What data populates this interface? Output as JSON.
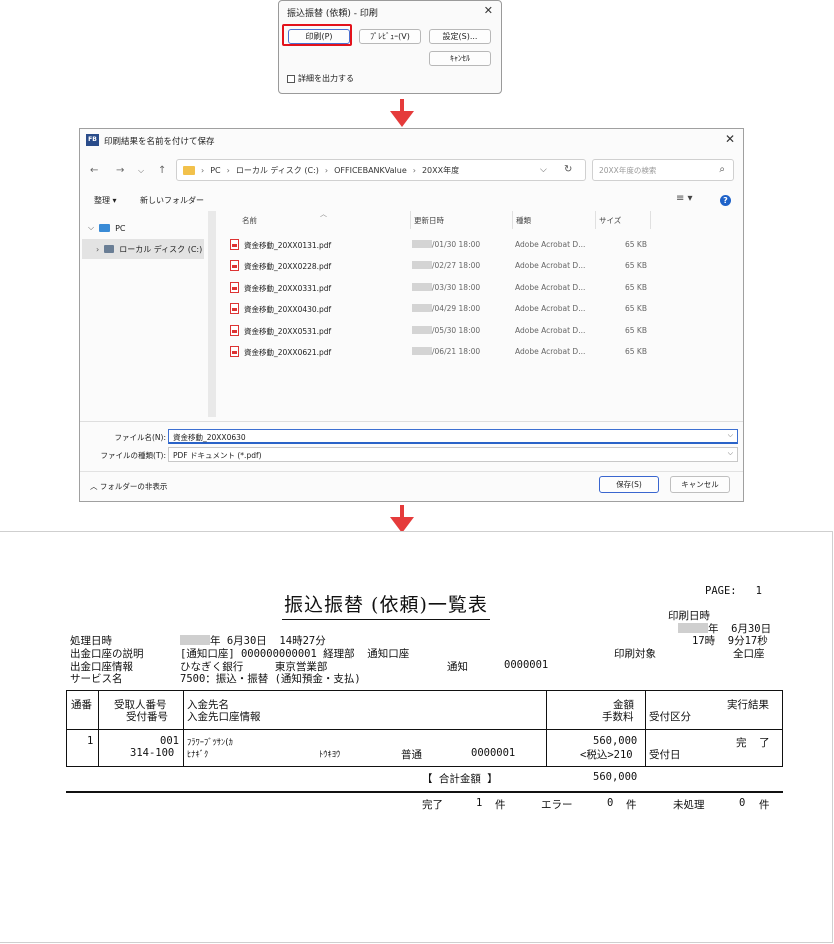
{
  "print_dialog": {
    "title": "振込振替 (依頼) - 印刷",
    "close_icon": "close-icon",
    "print_button": "印刷(P)",
    "preview_button": "ﾌﾟﾚﾋﾞｭｰ(V)",
    "settings_button": "設定(S)...",
    "cancel_button": "ｷｬﾝｾﾙ",
    "detail_checkbox_label": "詳細を出力する",
    "detail_checked": false,
    "highlight_color": "#e3121b"
  },
  "arrow_color": "#e53b3b",
  "save_dialog": {
    "app_icon_text": "FB",
    "title": "印刷結果を名前を付けて保存",
    "address": [
      "PC",
      "ローカル ディスク (C:)",
      "OFFICEBANKValue",
      "20XX年度"
    ],
    "search_placeholder": "20XX年度の検索",
    "toolbar": {
      "organize": "整理 ▾",
      "new_folder": "新しいフォルダー"
    },
    "nav": {
      "pc": "PC",
      "disk": "ローカル ディスク (C:)"
    },
    "columns": {
      "name": "名前",
      "modified": "更新日時",
      "type": "種類",
      "size": "サイズ"
    },
    "files": [
      {
        "name": "資金移動_20XX0131.pdf",
        "date": "/01/30 18:00",
        "type": "Adobe Acrobat D...",
        "size": "65 KB"
      },
      {
        "name": "資金移動_20XX0228.pdf",
        "date": "/02/27 18:00",
        "type": "Adobe Acrobat D...",
        "size": "65 KB"
      },
      {
        "name": "資金移動_20XX0331.pdf",
        "date": "/03/30 18:00",
        "type": "Adobe Acrobat D...",
        "size": "65 KB"
      },
      {
        "name": "資金移動_20XX0430.pdf",
        "date": "/04/29 18:00",
        "type": "Adobe Acrobat D...",
        "size": "65 KB"
      },
      {
        "name": "資金移動_20XX0531.pdf",
        "date": "/05/30 18:00",
        "type": "Adobe Acrobat D...",
        "size": "65 KB"
      },
      {
        "name": "資金移動_20XX0621.pdf",
        "date": "/06/21 18:00",
        "type": "Adobe Acrobat D...",
        "size": "65 KB"
      }
    ],
    "filename_label": "ファイル名(N):",
    "filename_value": "資金移動_20XX0630",
    "filetype_label": "ファイルの種類(T):",
    "filetype_value": "PDF ドキュメント (*.pdf)",
    "hide_folders": "フォルダーの非表示",
    "save_button": "保存(S)",
    "cancel_button": "キャンセル"
  },
  "report": {
    "page": "PAGE:   1",
    "title": "振込振替 (依頼)一覧表",
    "print_date_label": "印刷日時",
    "print_date": "年  6月30日",
    "print_time": "17時  9分17秒",
    "processing_label": "処理日時",
    "processing_value": "年 6月30日  14時27分",
    "account_desc_label": "出金口座の説明",
    "account_desc_value": "[通知口座] 000000000001 経理部  通知口座",
    "account_info_label": "出金口座情報",
    "account_info_value": "ひなぎく銀行     東京営業部",
    "account_type": "通知",
    "account_number": "0000001",
    "service_label": "サービス名",
    "service_value": "7500：振込・振替 (通知預金・支払)",
    "print_target_label": "印刷対象",
    "print_target_value": "全口座",
    "headers": {
      "seq": "通番",
      "recv_no": "受取人番号",
      "accept_no": "受付番号",
      "payee": "入金先名",
      "payee_account": "入金先口座情報",
      "amount": "金額",
      "fee": "手数料",
      "accept_type": "受付区分",
      "result": "実行結果"
    },
    "row": {
      "seq": "1",
      "recv_no": "001",
      "accept_no": "314-100",
      "payee_kana": "ﾌﾗﾜｰﾌﾞﾂｻﾝ(ｶ",
      "bank_kana": "ﾋﾅｷﾞｸ",
      "branch_kana": "ﾄｳｷﾖｳ",
      "acct_type": "普通",
      "acct_no": "0000001",
      "amount": "560,000",
      "fee": "<税込>210",
      "accept_date": "受付日",
      "result": "完  了"
    },
    "total_label": "【 合計金額 】",
    "total_value": "560,000",
    "summary": {
      "done_label": "完了",
      "done": "1",
      "done_unit": "件",
      "error_label": "エラー",
      "error": "0",
      "error_unit": "件",
      "pending_label": "未処理",
      "pending": "0",
      "pending_unit": "件"
    }
  }
}
